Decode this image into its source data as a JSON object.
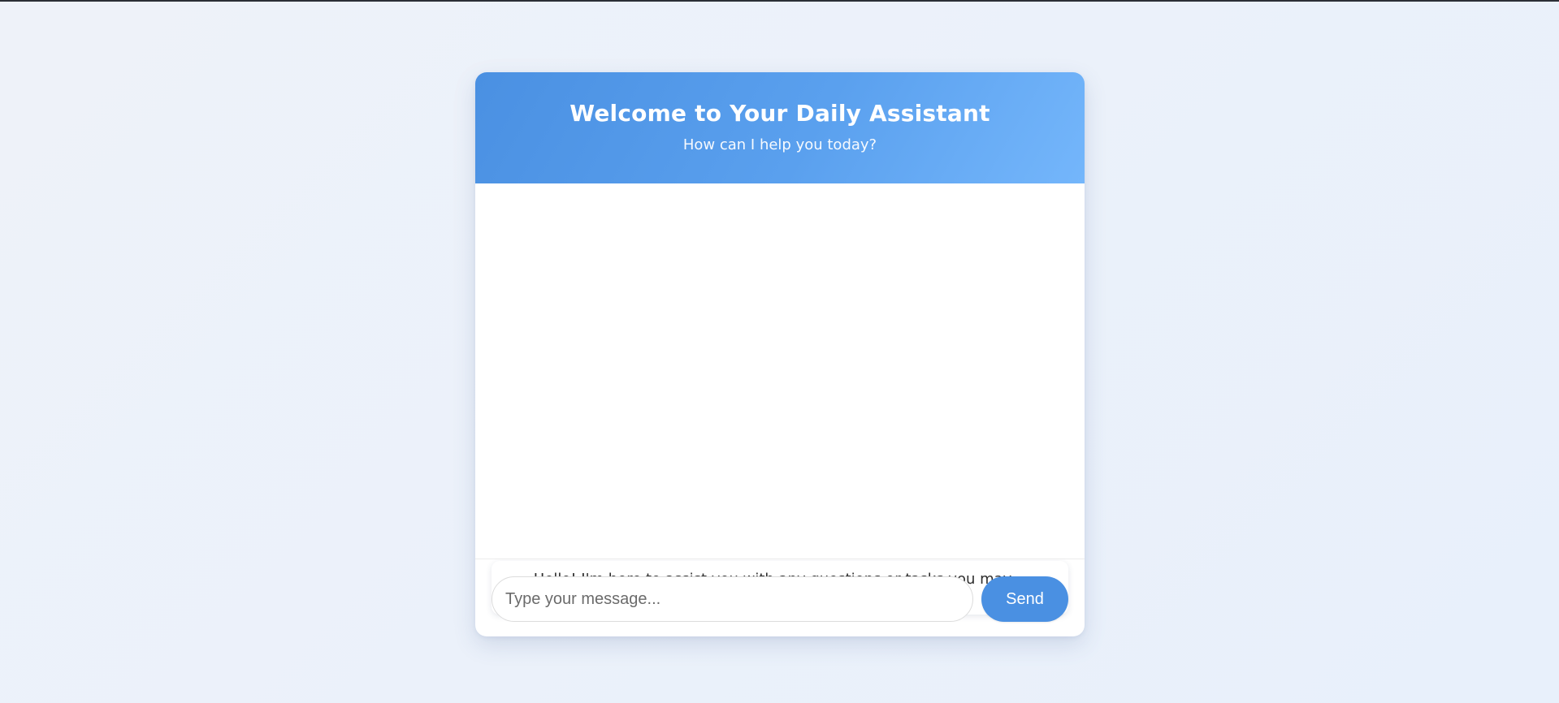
{
  "header": {
    "title": "Welcome to Your Daily Assistant",
    "subtitle": "How can I help you today?"
  },
  "messages": [
    {
      "icon": "waving-hand-icon",
      "emoji": "👋",
      "text": "Hello! I'm here to assist you with any questions or tasks you may have."
    }
  ],
  "input": {
    "placeholder": "Type your message...",
    "value": ""
  },
  "send_button": {
    "label": "Send"
  },
  "colors": {
    "accent": "#4a90e2",
    "header_gradient_end": "#74b6fb",
    "background": "#eef2f9"
  }
}
